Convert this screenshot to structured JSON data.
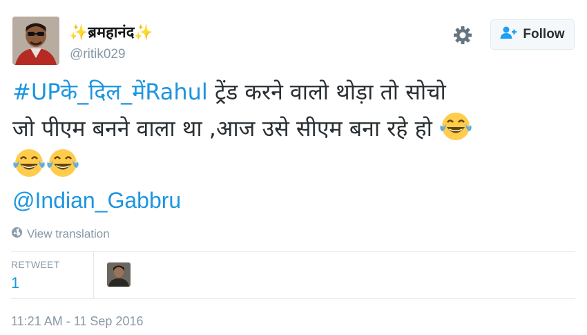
{
  "user": {
    "name_sparkle_left": "✨",
    "name": "ब्रमहानंद",
    "name_sparkle_right": "✨",
    "handle": "@ritik029",
    "avatar_icon": "user-avatar"
  },
  "actions": {
    "settings_icon": "gear-icon",
    "follow_label": "Follow"
  },
  "tweet": {
    "hashtag": "#UPके_दिल_मेंRahul",
    "text_line1": " ट्रेंड करने वालो थोड़ा तो सोचो",
    "text_line2": "जो पीएम बनने वाला था ,आज उसे सीएम बना रहे हो",
    "emoji": "face-with-tears-of-joy",
    "emoji_count": 3,
    "mention": "@Indian_Gabbru"
  },
  "translation": {
    "label": "View translation"
  },
  "stats": {
    "retweet_label": "RETWEET",
    "retweet_count": "1"
  },
  "timestamp": "11:21 AM - 11 Sep 2016",
  "colors": {
    "link": "#1b95e0",
    "muted": "#8899a6",
    "text": "#292f33",
    "border": "#e1e8ed"
  }
}
